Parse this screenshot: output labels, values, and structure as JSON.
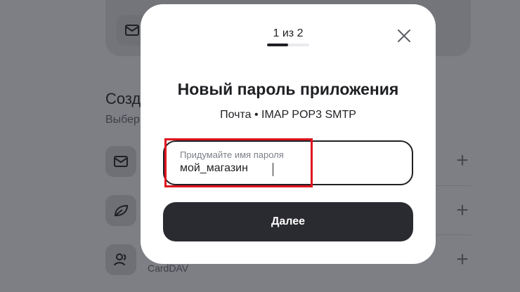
{
  "background": {
    "section_heading": "Созда",
    "section_subtitle": "Выбер",
    "row_caption": "CardDAV",
    "icons": [
      "mail-icon",
      "mail-icon",
      "leaf-icon",
      "contacts-icon"
    ]
  },
  "modal": {
    "step": "1 из 2",
    "progress": 0.5,
    "title": "Новый пароль приложения",
    "subtitle": "Почта • IMAP POP3 SMTP",
    "field": {
      "label": "Придумайте имя пароля",
      "value": "мой_магазин"
    },
    "next_label": "Далее",
    "close_icon": "close-icon"
  },
  "colors": {
    "primary_button": "#2a2a31",
    "highlight": "#e0141e",
    "overlay": "#7d7f85"
  }
}
